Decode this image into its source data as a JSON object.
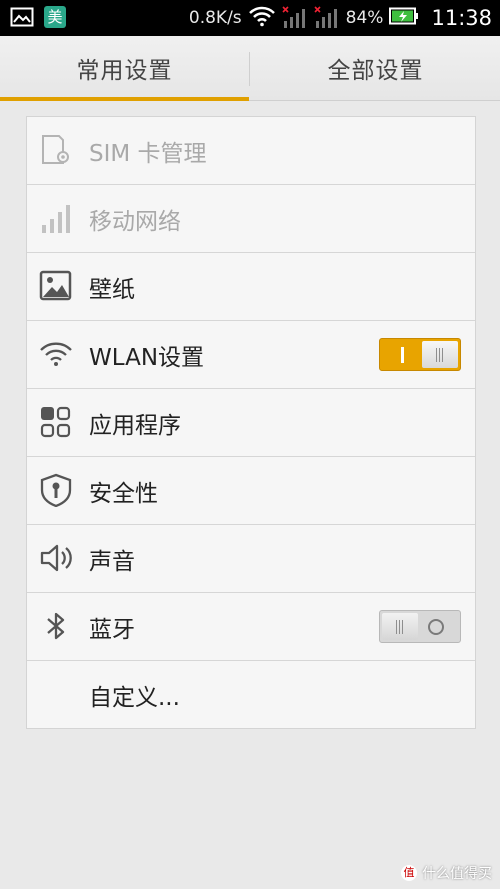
{
  "status_bar": {
    "app_badge": "美",
    "net_speed": "0.8K/s",
    "battery": "84%",
    "time": "11:38"
  },
  "tabs": [
    {
      "label": "常用设置",
      "selected": true
    },
    {
      "label": "全部设置",
      "selected": false
    }
  ],
  "settings": [
    {
      "label": "SIM 卡管理",
      "icon": "sim-card-icon",
      "enabled": false
    },
    {
      "label": "移动网络",
      "icon": "signal-bars-icon",
      "enabled": false
    },
    {
      "label": "壁纸",
      "icon": "image-icon",
      "enabled": true
    },
    {
      "label": "WLAN设置",
      "icon": "wifi-icon",
      "enabled": true,
      "toggle": "on"
    },
    {
      "label": "应用程序",
      "icon": "apps-grid-icon",
      "enabled": true
    },
    {
      "label": "安全性",
      "icon": "shield-lock-icon",
      "enabled": true
    },
    {
      "label": "声音",
      "icon": "speaker-icon",
      "enabled": true
    },
    {
      "label": "蓝牙",
      "icon": "bluetooth-icon",
      "enabled": true,
      "toggle": "off"
    },
    {
      "label": "自定义...",
      "icon": "",
      "enabled": true
    }
  ],
  "watermark": {
    "text": "什么值得买",
    "logo": "值"
  },
  "colors": {
    "accent": "#e8a400",
    "background": "#e9e9e9",
    "list_bg": "#f6f6f6",
    "disabled_text": "#a9a9a9"
  }
}
